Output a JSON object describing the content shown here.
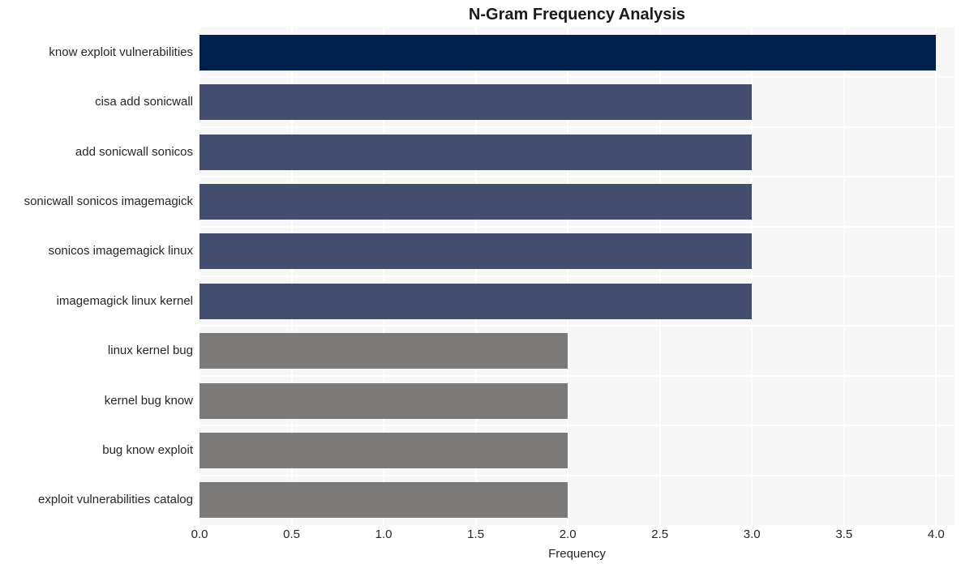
{
  "chart_data": {
    "type": "bar",
    "orientation": "horizontal",
    "title": "N-Gram Frequency Analysis",
    "xlabel": "Frequency",
    "ylabel": "",
    "categories": [
      "know exploit vulnerabilities",
      "cisa add sonicwall",
      "add sonicwall sonicos",
      "sonicwall sonicos imagemagick",
      "sonicos imagemagick linux",
      "imagemagick linux kernel",
      "linux kernel bug",
      "kernel bug know",
      "bug know exploit",
      "exploit vulnerabilities catalog"
    ],
    "values": [
      4,
      3,
      3,
      3,
      3,
      3,
      2,
      2,
      2,
      2
    ],
    "bar_colors": [
      "#00214e",
      "#434e6e",
      "#434e6e",
      "#434e6e",
      "#434e6e",
      "#434e6e",
      "#7b7a78",
      "#7b7a78",
      "#7b7a78",
      "#7b7a78"
    ],
    "xlim": [
      0,
      4.1
    ],
    "xticks": [
      0.0,
      0.5,
      1.0,
      1.5,
      2.0,
      2.5,
      3.0,
      3.5,
      4.0
    ],
    "xticklabels": [
      "0.0",
      "0.5",
      "1.0",
      "1.5",
      "2.0",
      "2.5",
      "3.0",
      "3.5",
      "4.0"
    ],
    "grid": true,
    "grid_color": "#ffffff",
    "plot_background": "#f7f7f7",
    "figure_background": "#ffffff",
    "legend": null,
    "legend_position": "none"
  }
}
